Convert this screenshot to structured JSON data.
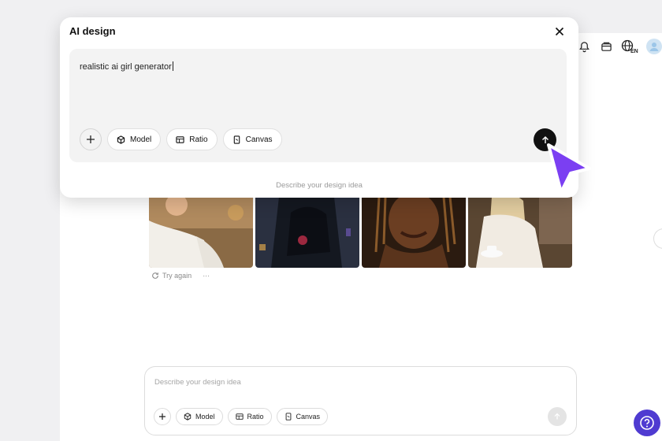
{
  "dialog": {
    "title": "AI design",
    "input_value": "realistic ai girl generator",
    "tools": {
      "model": "Model",
      "ratio": "Ratio",
      "canvas": "Canvas"
    },
    "hint": "Describe your design idea"
  },
  "header": {
    "icons": [
      "bell-icon",
      "card-icon",
      "language-icon",
      "avatar"
    ],
    "language": "EN"
  },
  "results": {
    "try_again": "Try again",
    "more": "···"
  },
  "bottom_input": {
    "placeholder": "Describe your design idea",
    "tools": {
      "model": "Model",
      "ratio": "Ratio",
      "canvas": "Canvas"
    }
  },
  "help": {
    "label": "?"
  },
  "colors": {
    "accent": "#7b3ff2",
    "help": "#4f3bd1",
    "send_active": "#111111",
    "send_disabled": "#e4e4e4"
  }
}
